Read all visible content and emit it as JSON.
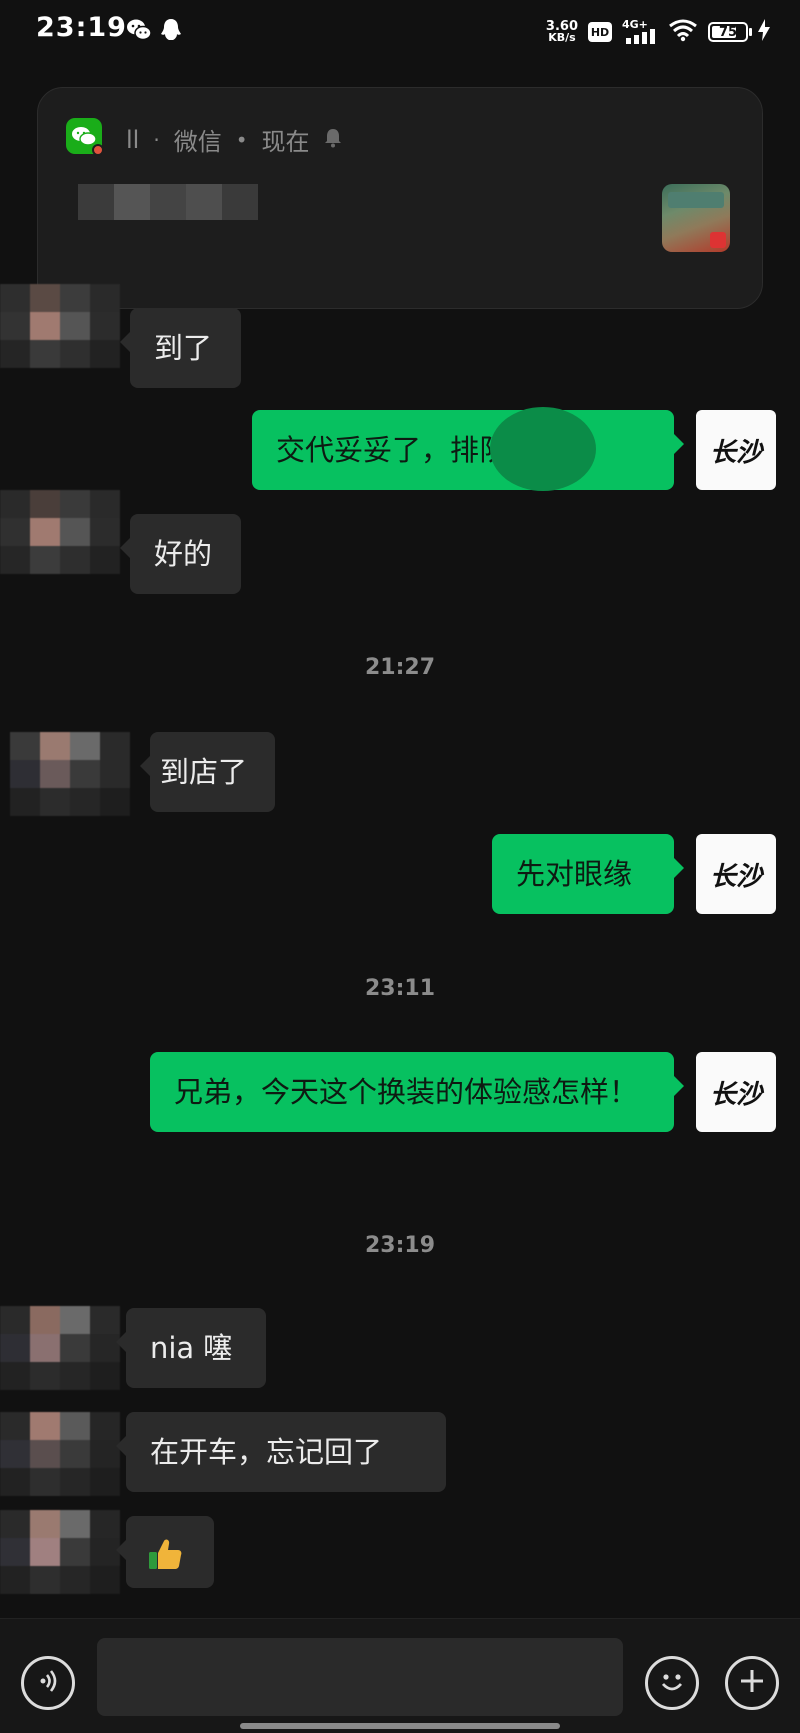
{
  "status_bar": {
    "time": "23:19",
    "left_icons": [
      "wechat-icon",
      "qq-penguin-icon"
    ],
    "net_speed_value": "3.60",
    "net_speed_unit": "KB/s",
    "hd_label": "HD",
    "network_label": "4G+",
    "battery_percent": "75",
    "battery_level": 0.75,
    "charging": true
  },
  "notification": {
    "app_icon": "wechat-icon",
    "sender": "ll",
    "app_name": "微信",
    "time": "现在",
    "bell_icon": "bell-icon"
  },
  "messages": [
    {
      "side": "in",
      "text": "到了"
    },
    {
      "side": "out",
      "text": "交代妥妥了，排队预约"
    },
    {
      "side": "in",
      "text": "好的"
    },
    {
      "type": "time",
      "text": "21:27"
    },
    {
      "side": "in",
      "text": "到店了"
    },
    {
      "side": "out",
      "text": "先对眼缘"
    },
    {
      "type": "time",
      "text": "23:11"
    },
    {
      "side": "out",
      "text": "兄弟，今天这个换装的体验感怎样！"
    },
    {
      "type": "time",
      "text": "23:19"
    },
    {
      "side": "in",
      "text": "nia 噻"
    },
    {
      "side": "in",
      "text": "在开车，忘记回了"
    },
    {
      "side": "in",
      "emoji": "thumbs-up-icon"
    }
  ],
  "my_avatar_text": "长沙",
  "input_bar": {
    "voice_icon": "voice-icon",
    "emoji_icon": "emoji-icon",
    "plus_icon": "plus-icon",
    "placeholder": ""
  },
  "colors": {
    "background": "#111111",
    "incoming_bubble": "#2b2b2b",
    "outgoing_bubble": "#07c160",
    "wechat_green": "#1aad19"
  }
}
